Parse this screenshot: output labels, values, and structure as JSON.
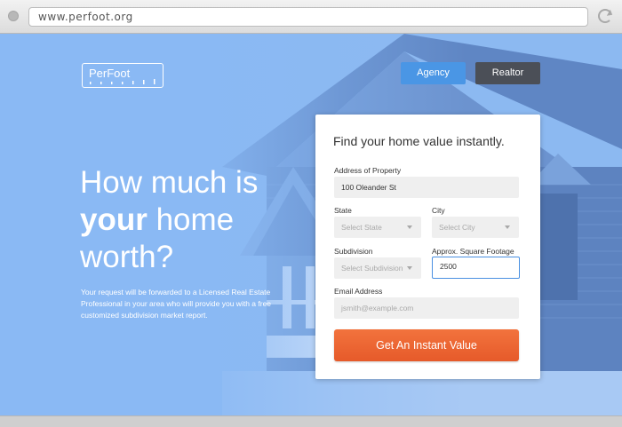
{
  "browser": {
    "url": "www.perfoot.org"
  },
  "brand": {
    "logo_text": "PerFoot"
  },
  "nav": {
    "agency_label": "Agency",
    "realtor_label": "Realtor"
  },
  "hero": {
    "line1": "How much is",
    "line2_bold": "your",
    "line2_rest": " home",
    "line3": "worth?",
    "subtext": "Your request will be forwarded to a Licensed Real Estate Professional in your area who will provide you with a free customized subdivision market report."
  },
  "form": {
    "title": "Find your home value instantly.",
    "address_label": "Address of Property",
    "address_value": "100 Oleander St",
    "state_label": "State",
    "state_value": "Select State",
    "city_label": "City",
    "city_value": "Select City",
    "subdivision_label": "Subdivision",
    "subdivision_value": "Select Subdivision",
    "sqft_label": "Approx. Square Footage",
    "sqft_value": "2500",
    "email_label": "Email Address",
    "email_placeholder": "jsmith@example.com",
    "submit_label": "Get An Instant Value"
  },
  "colors": {
    "accent_blue": "#4a96e5",
    "dark_button": "#4b4f57",
    "cta_orange": "#ec6431",
    "hero_blue": "#8ab8f2"
  }
}
